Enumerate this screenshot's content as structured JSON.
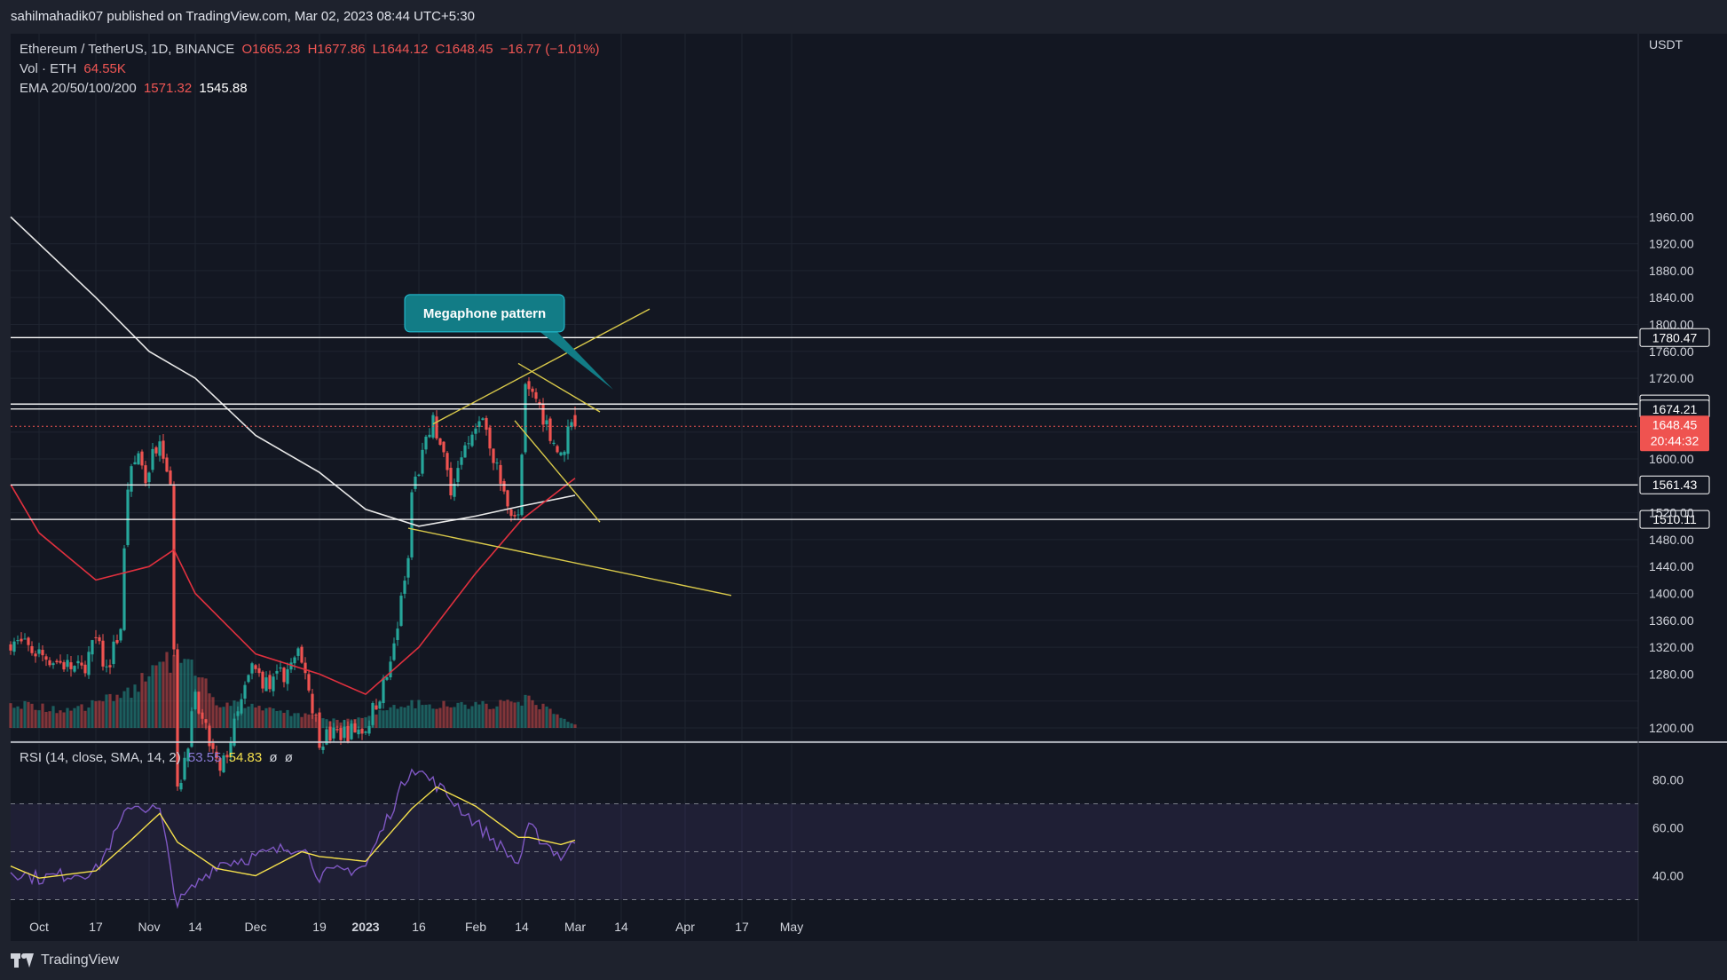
{
  "header": {
    "published": "sahilmahadik07 published on TradingView.com, Mar 02, 2023 08:44 UTC+5:30"
  },
  "legend": {
    "symbol": "Ethereum / TetherUS, 1D, BINANCE",
    "open": "O1665.23",
    "high": "H1677.86",
    "low": "L1644.12",
    "close": "C1648.45",
    "change": "−16.77 (−1.01%)",
    "vol_label": "Vol · ETH",
    "vol_value": "64.55K",
    "ema_label": "EMA 20/50/100/200",
    "ema_value_1": "1571.32",
    "ema_value_2": "1545.88",
    "rsi_label": "RSI (14, close, SMA, 14, 2)",
    "rsi_value_1": "53.55",
    "rsi_value_2": "54.83",
    "rsi_na_1": "ø",
    "rsi_na_2": "ø"
  },
  "annotation": {
    "text": "Megaphone pattern"
  },
  "footer": {
    "brand": "TradingView"
  },
  "colors": {
    "background": "#131722",
    "frame": "#1e222d",
    "up": "#26a69a",
    "down": "#ef5350",
    "ema_red": "#e0303e",
    "ema_white": "#e8e8e8",
    "trendline": "#d9c94a",
    "rsi_line": "#7e57c2",
    "rsi_sma": "#f5e04c",
    "callout": "#127c86"
  },
  "chart_data": {
    "type": "candlestick",
    "quote_currency": "USDT",
    "y_ticks": [
      1200,
      1240,
      1280,
      1320,
      1360,
      1400,
      1440,
      1480,
      1520,
      1560,
      1600,
      1640,
      1680,
      1720,
      1760,
      1800,
      1840,
      1880,
      1920,
      1960
    ],
    "y_tick_labels": [
      "1200.00",
      "",
      "1280.00",
      "1320.00",
      "1360.00",
      "1400.00",
      "1440.00",
      "1480.00",
      "1520.00",
      "",
      "1600.00",
      "",
      "",
      "1720.00",
      "1760.00",
      "1800.00",
      "1840.00",
      "1880.00",
      "1920.00",
      "1960.00"
    ],
    "x_tick_labels": [
      {
        "label": "Oct",
        "date": "2022-10-01"
      },
      {
        "label": "17",
        "date": "2022-10-17"
      },
      {
        "label": "Nov",
        "date": "2022-11-01"
      },
      {
        "label": "14",
        "date": "2022-11-14"
      },
      {
        "label": "Dec",
        "date": "2022-12-01"
      },
      {
        "label": "19",
        "date": "2022-12-19"
      },
      {
        "label": "2023",
        "date": "2023-01-01"
      },
      {
        "label": "16",
        "date": "2023-01-16"
      },
      {
        "label": "Feb",
        "date": "2023-02-01"
      },
      {
        "label": "14",
        "date": "2023-02-14"
      },
      {
        "label": "Mar",
        "date": "2023-03-01"
      },
      {
        "label": "14",
        "date": "2023-03-14"
      },
      {
        "label": "Apr",
        "date": "2023-04-01"
      },
      {
        "label": "17",
        "date": "2023-04-17"
      },
      {
        "label": "May",
        "date": "2023-05-01"
      }
    ],
    "horizontal_levels": [
      {
        "price": 1780.47,
        "label": "1780.47"
      },
      {
        "price": 1681.62,
        "label": "1681.62"
      },
      {
        "price": 1674.21,
        "label": "1674.21"
      },
      {
        "price": 1561.43,
        "label": "1561.43"
      },
      {
        "price": 1510.11,
        "label": "1510.11"
      }
    ],
    "last_price": {
      "price": 1648.45,
      "label": "1648.45",
      "countdown": "20:44:32"
    },
    "trendlines": [
      {
        "from": [
          "2023-01-20",
          1652
        ],
        "to": [
          "2023-03-22",
          1823
        ]
      },
      {
        "from": [
          "2023-01-13",
          1497
        ],
        "to": [
          "2023-04-14",
          1397
        ]
      },
      {
        "from": [
          "2023-02-13",
          1742
        ],
        "to": [
          "2023-03-08",
          1670
        ]
      },
      {
        "from": [
          "2023-02-12",
          1657
        ],
        "to": [
          "2023-03-08",
          1506
        ]
      }
    ],
    "candles_sampled": [
      {
        "date": "2022-09-23",
        "close": 1330
      },
      {
        "date": "2022-10-01",
        "close": 1310
      },
      {
        "date": "2022-10-10",
        "close": 1290
      },
      {
        "date": "2022-10-13",
        "close": 1285
      },
      {
        "date": "2022-10-17",
        "close": 1330
      },
      {
        "date": "2022-10-20",
        "close": 1285
      },
      {
        "date": "2022-10-24",
        "close": 1350
      },
      {
        "date": "2022-10-25",
        "close": 1460
      },
      {
        "date": "2022-10-26",
        "close": 1560
      },
      {
        "date": "2022-10-29",
        "close": 1610
      },
      {
        "date": "2022-10-31",
        "close": 1570
      },
      {
        "date": "2022-11-04",
        "close": 1640
      },
      {
        "date": "2022-11-07",
        "close": 1565
      },
      {
        "date": "2022-11-08",
        "close": 1330
      },
      {
        "date": "2022-11-09",
        "close": 1100
      },
      {
        "date": "2022-11-14",
        "close": 1240
      },
      {
        "date": "2022-11-21",
        "close": 1130
      },
      {
        "date": "2022-11-30",
        "close": 1290
      },
      {
        "date": "2022-12-05",
        "close": 1260
      },
      {
        "date": "2022-12-14",
        "close": 1310
      },
      {
        "date": "2022-12-19",
        "close": 1185
      },
      {
        "date": "2023-01-01",
        "close": 1200
      },
      {
        "date": "2023-01-08",
        "close": 1290
      },
      {
        "date": "2023-01-13",
        "close": 1450
      },
      {
        "date": "2023-01-14",
        "close": 1550
      },
      {
        "date": "2023-01-20",
        "close": 1655
      },
      {
        "date": "2023-01-25",
        "close": 1560
      },
      {
        "date": "2023-02-01",
        "close": 1640
      },
      {
        "date": "2023-02-03",
        "close": 1665
      },
      {
        "date": "2023-02-09",
        "close": 1545
      },
      {
        "date": "2023-02-13",
        "close": 1510
      },
      {
        "date": "2023-02-15",
        "close": 1700
      },
      {
        "date": "2023-02-18",
        "close": 1690
      },
      {
        "date": "2023-02-22",
        "close": 1640
      },
      {
        "date": "2023-02-25",
        "close": 1600
      },
      {
        "date": "2023-02-28",
        "close": 1665
      },
      {
        "date": "2023-03-01",
        "close": 1648.45
      }
    ],
    "ema_200_sampled": [
      {
        "date": "2022-09-23",
        "close": 1960
      },
      {
        "date": "2022-10-17",
        "close": 1840
      },
      {
        "date": "2022-11-01",
        "close": 1760
      },
      {
        "date": "2022-11-14",
        "close": 1720
      },
      {
        "date": "2022-12-01",
        "close": 1635
      },
      {
        "date": "2022-12-19",
        "close": 1580
      },
      {
        "date": "2023-01-01",
        "close": 1525
      },
      {
        "date": "2023-01-16",
        "close": 1500
      },
      {
        "date": "2023-02-01",
        "close": 1515
      },
      {
        "date": "2023-02-14",
        "close": 1530
      },
      {
        "date": "2023-03-01",
        "close": 1545.88
      }
    ],
    "ema_50_sampled": [
      {
        "date": "2022-09-23",
        "close": 1562
      },
      {
        "date": "2022-10-01",
        "close": 1490
      },
      {
        "date": "2022-10-17",
        "close": 1420
      },
      {
        "date": "2022-11-01",
        "close": 1440
      },
      {
        "date": "2022-11-08",
        "close": 1465
      },
      {
        "date": "2022-11-14",
        "close": 1400
      },
      {
        "date": "2022-12-01",
        "close": 1310
      },
      {
        "date": "2022-12-19",
        "close": 1280
      },
      {
        "date": "2023-01-01",
        "close": 1250
      },
      {
        "date": "2023-01-16",
        "close": 1320
      },
      {
        "date": "2023-02-01",
        "close": 1430
      },
      {
        "date": "2023-02-14",
        "close": 1510
      },
      {
        "date": "2023-03-01",
        "close": 1571.32
      }
    ],
    "volume_sampled": [
      {
        "date": "2022-09-23",
        "volume": 450
      },
      {
        "date": "2022-10-10",
        "volume": 300
      },
      {
        "date": "2022-10-26",
        "volume": 650
      },
      {
        "date": "2022-11-08",
        "volume": 1200
      },
      {
        "date": "2022-11-09",
        "volume": 1500
      },
      {
        "date": "2022-11-20",
        "volume": 450
      },
      {
        "date": "2022-12-10",
        "volume": 280
      },
      {
        "date": "2022-12-25",
        "volume": 120
      },
      {
        "date": "2023-01-14",
        "volume": 420
      },
      {
        "date": "2023-02-01",
        "volume": 380
      },
      {
        "date": "2023-02-16",
        "volume": 500
      },
      {
        "date": "2023-03-01",
        "volume": 64.55
      }
    ],
    "rsi": {
      "y_tick_labels": [
        "40.00",
        "60.00",
        "80.00"
      ],
      "bands": [
        30,
        50,
        70
      ],
      "sampled": [
        {
          "date": "2022-09-23",
          "rsi": 42,
          "sma": 44
        },
        {
          "date": "2022-10-01",
          "rsi": 39,
          "sma": 39
        },
        {
          "date": "2022-10-17",
          "rsi": 42,
          "sma": 42
        },
        {
          "date": "2022-10-27",
          "rsi": 70,
          "sma": 55
        },
        {
          "date": "2022-11-04",
          "rsi": 67,
          "sma": 66
        },
        {
          "date": "2022-11-09",
          "rsi": 28,
          "sma": 54
        },
        {
          "date": "2022-11-20",
          "rsi": 45,
          "sma": 43
        },
        {
          "date": "2022-12-01",
          "rsi": 48,
          "sma": 40
        },
        {
          "date": "2022-12-14",
          "rsi": 53,
          "sma": 50
        },
        {
          "date": "2022-12-19",
          "rsi": 40,
          "sma": 48
        },
        {
          "date": "2023-01-01",
          "rsi": 44,
          "sma": 46
        },
        {
          "date": "2023-01-14",
          "rsi": 86,
          "sma": 68
        },
        {
          "date": "2023-01-21",
          "rsi": 78,
          "sma": 77
        },
        {
          "date": "2023-02-01",
          "rsi": 62,
          "sma": 69
        },
        {
          "date": "2023-02-13",
          "rsi": 45,
          "sma": 56
        },
        {
          "date": "2023-02-16",
          "rsi": 60,
          "sma": 56
        },
        {
          "date": "2023-02-25",
          "rsi": 48,
          "sma": 53
        },
        {
          "date": "2023-03-01",
          "rsi": 53.55,
          "sma": 54.83
        }
      ]
    }
  }
}
